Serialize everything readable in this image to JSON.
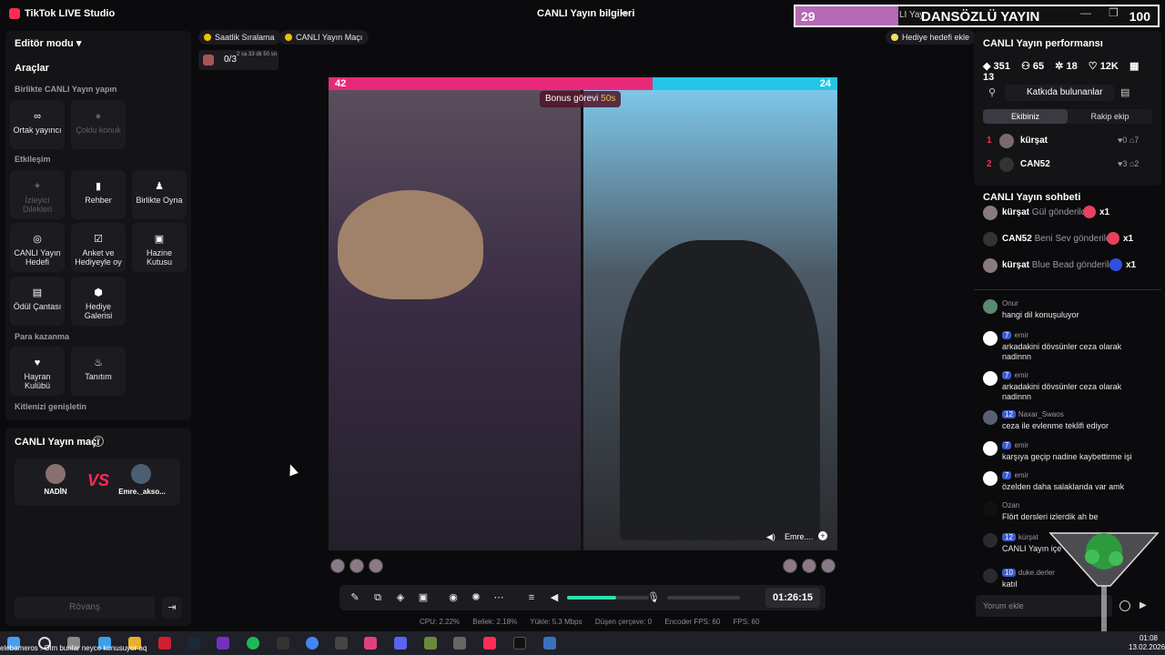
{
  "titlebar": {
    "app": "TikTok LIVE Studio",
    "live_info": "CANLI Yayın bilgileri"
  },
  "overlay": {
    "left_value": "29",
    "tail_text": "LI Yay",
    "title": "DANSÖZLÜ YAYIN",
    "right_value": "100"
  },
  "sidebar": {
    "editor_mode": "Editör modu",
    "tools_title": "Araçlar",
    "sec_together": "Birlikte CANLI Yayın yapın",
    "sec_interaction": "Etkileşim",
    "sec_monetize": "Para kazanma",
    "sec_expand": "Kitlenizi genişletin",
    "tools": [
      {
        "label": "Ortak yayıncı",
        "icon": "link-icon"
      },
      {
        "label": "Çoklu konuk",
        "icon": "guests-icon"
      },
      {
        "label": "İzleyici Dilekleri",
        "icon": "wish-icon"
      },
      {
        "label": "Rehber",
        "icon": "guide-icon"
      },
      {
        "label": "Birlikte Oyna",
        "icon": "play-together-icon"
      },
      {
        "label": "CANLI Yayın Hedefi",
        "icon": "target-icon"
      },
      {
        "label": "Anket ve Hediyeyle oy",
        "icon": "poll-icon"
      },
      {
        "label": "Hazine Kutusu",
        "icon": "treasure-icon"
      },
      {
        "label": "Ödül Çantası",
        "icon": "reward-bag-icon"
      },
      {
        "label": "Hediye Galerisi",
        "icon": "gift-gallery-icon"
      },
      {
        "label": "Hayran Kulübü",
        "icon": "fan-club-icon"
      },
      {
        "label": "Tanıtım",
        "icon": "promote-icon"
      }
    ]
  },
  "match": {
    "title": "CANLI Yayın maçı",
    "host": "NADİN",
    "opponent": "Emre._akso...",
    "rematch": "Rövanş"
  },
  "center": {
    "chip_hourly": "Saatlik Sıralama",
    "chip_match": "CANLI Yayın Maçı",
    "goal_add": "Hediye hedefi ekle",
    "goal_progress": "0/3",
    "goal_time": "2 sa 33 dk 50 sn",
    "score_left": "42",
    "score_right": "24",
    "score_left_share": 0.636,
    "bonus_label": "Bonus görevi",
    "bonus_time": "50s",
    "remote_name": "Emre....",
    "timer": "01:26:15",
    "volume_level": 0.6
  },
  "stats": {
    "cpu": "CPU: 2.22%",
    "memory": "Bellek: 2.18%",
    "upload": "Yükle: 5.3 Mbps",
    "dropped": "Düşen çerçeve: 0",
    "encoder_fps": "Encoder FPS: 60",
    "fps": "FPS: 60"
  },
  "performance": {
    "title": "CANLI Yayın performansı",
    "metrics": [
      "351",
      "65",
      "18",
      "12K",
      "13"
    ],
    "contrib": "Katkıda bulunanlar",
    "tab_team": "Ekibiniz",
    "tab_rival": "Rakip ekip",
    "ranks": [
      {
        "n": "1",
        "name": "kürşat",
        "a": "0",
        "b": "7"
      },
      {
        "n": "2",
        "name": "CAN52",
        "a": "3",
        "b": "2"
      }
    ]
  },
  "chat": {
    "title": "CANLI Yayın sohbeti",
    "gifts": [
      {
        "user": "kürşat",
        "text": "Gül gönderildi",
        "count": "x1"
      },
      {
        "user": "CAN52",
        "text": "Beni Sev gönderildi",
        "count": "x1"
      },
      {
        "user": "kürşat",
        "text": "Blue Bead gönderildi",
        "count": "x1"
      }
    ],
    "messages": [
      {
        "user": "Onur",
        "level": "",
        "text": "hangi dil konuşuluyor"
      },
      {
        "user": "emir",
        "level": "7",
        "text": "arkadakini dövsünler ceza olarak nadinnn"
      },
      {
        "user": "emir",
        "level": "7",
        "text": "arkadakini dövsünler ceza olarak nadinnn"
      },
      {
        "user": "Naxar_Swaos",
        "level": "12",
        "text": "ceza ile evlenme teklifi ediyor"
      },
      {
        "user": "emir",
        "level": "7",
        "text": "karşıya geçip nadine kaybettirme işi"
      },
      {
        "user": "emir",
        "level": "7",
        "text": "özelden daha salaklanda var amk"
      },
      {
        "user": "Ozan",
        "level": "",
        "text": "Flört dersleri izlerdik ah be"
      },
      {
        "user": "kürşat",
        "level": "12",
        "text": "CANLI Yayın içe"
      },
      {
        "user": "duke.derler",
        "level": "10",
        "text": "katıl"
      }
    ],
    "comment_placeholder": "Yorum ekle"
  },
  "taskbar": {
    "ticker": "elebameros : Olm bunlar neyce konusuyor aq",
    "time": "01:08",
    "date": "13.02.2026"
  }
}
